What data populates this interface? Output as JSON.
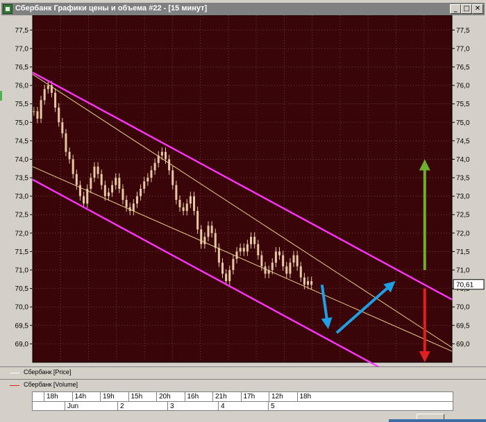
{
  "window": {
    "title": "Сбербанк Графики цены и объема #22 - [15 минут]",
    "buttons": {
      "minimize": "_",
      "restore": "□",
      "close": "✕"
    }
  },
  "chart_data": {
    "type": "candlestick",
    "y_axis": {
      "ticks": [
        "77,5",
        "77,0",
        "76,5",
        "76,0",
        "75,5",
        "75,0",
        "74,5",
        "74,0",
        "73,5",
        "73,0",
        "72,5",
        "72,0",
        "71,5",
        "71,0",
        "70,5",
        "70,0",
        "69,5",
        "69,0"
      ],
      "range": [
        68.5,
        77.9
      ]
    },
    "last_price_label": "70,61",
    "colors": {
      "plot_bg": "#3a0508",
      "grid": "#7a3a3a",
      "candles": "#e6c9a3",
      "channel": "#ff33ff",
      "trend_lines": "#e8d08a",
      "arrow_blue": "#1ea0e6",
      "arrow_green": "#6cb030",
      "arrow_red": "#e02020"
    },
    "price_series": [
      75.3,
      75.1,
      75.6,
      75.9,
      76.0,
      75.8,
      75.4,
      75.0,
      74.7,
      74.2,
      74.0,
      73.6,
      73.3,
      73.0,
      72.8,
      73.2,
      73.5,
      73.8,
      73.6,
      73.3,
      73.0,
      73.1,
      73.3,
      73.5,
      73.2,
      72.9,
      72.7,
      72.6,
      72.8,
      73.0,
      73.2,
      73.4,
      73.5,
      73.7,
      73.9,
      74.1,
      74.2,
      74.0,
      73.7,
      73.3,
      72.9,
      72.7,
      72.6,
      72.8,
      73.0,
      72.6,
      72.1,
      71.7,
      71.9,
      72.2,
      72.0,
      71.6,
      71.2,
      70.9,
      70.7,
      71.0,
      71.3,
      71.5,
      71.6,
      71.5,
      71.7,
      71.9,
      71.7,
      71.4,
      71.1,
      70.9,
      71.0,
      71.2,
      71.5,
      71.4,
      71.1,
      70.9,
      71.2,
      71.4,
      71.1,
      70.8,
      70.6,
      70.7,
      70.6
    ],
    "channel_lines": [
      {
        "from": [
          0,
          76.35
        ],
        "to": [
          100,
          70.2
        ]
      },
      {
        "from": [
          0,
          73.45
        ],
        "to": [
          100,
          67.3
        ]
      }
    ],
    "trend_lines": [
      {
        "from": [
          0,
          76.3
        ],
        "to": [
          100,
          68.9
        ]
      },
      {
        "from": [
          0,
          73.8
        ],
        "to": [
          100,
          68.8
        ]
      }
    ],
    "annotations": [
      {
        "type": "arrow",
        "color": "blue",
        "from": [
          69.0,
          70.6
        ],
        "to": [
          70.5,
          69.4
        ]
      },
      {
        "type": "arrow",
        "color": "blue",
        "from": [
          72.5,
          69.3
        ],
        "to": [
          86.5,
          70.7
        ]
      },
      {
        "type": "arrow",
        "color": "green",
        "from": [
          93.5,
          71.0
        ],
        "to": [
          93.5,
          74.0
        ]
      },
      {
        "type": "arrow",
        "color": "red",
        "from": [
          93.5,
          70.5
        ],
        "to": [
          93.5,
          68.5
        ]
      }
    ]
  },
  "legend": {
    "price": {
      "label": "Сбербанк [Price]",
      "color": "#ffffff"
    },
    "volume": {
      "label": "Сбербанк [Volume]",
      "color": "#e02020"
    }
  },
  "time_axis": {
    "hours": [
      "18h",
      "14h",
      "19h",
      "15h",
      "20h",
      "16h",
      "21h",
      "17h",
      "12h",
      "18h"
    ],
    "dates": [
      "Jun",
      "2",
      "3",
      "4",
      "5"
    ]
  }
}
